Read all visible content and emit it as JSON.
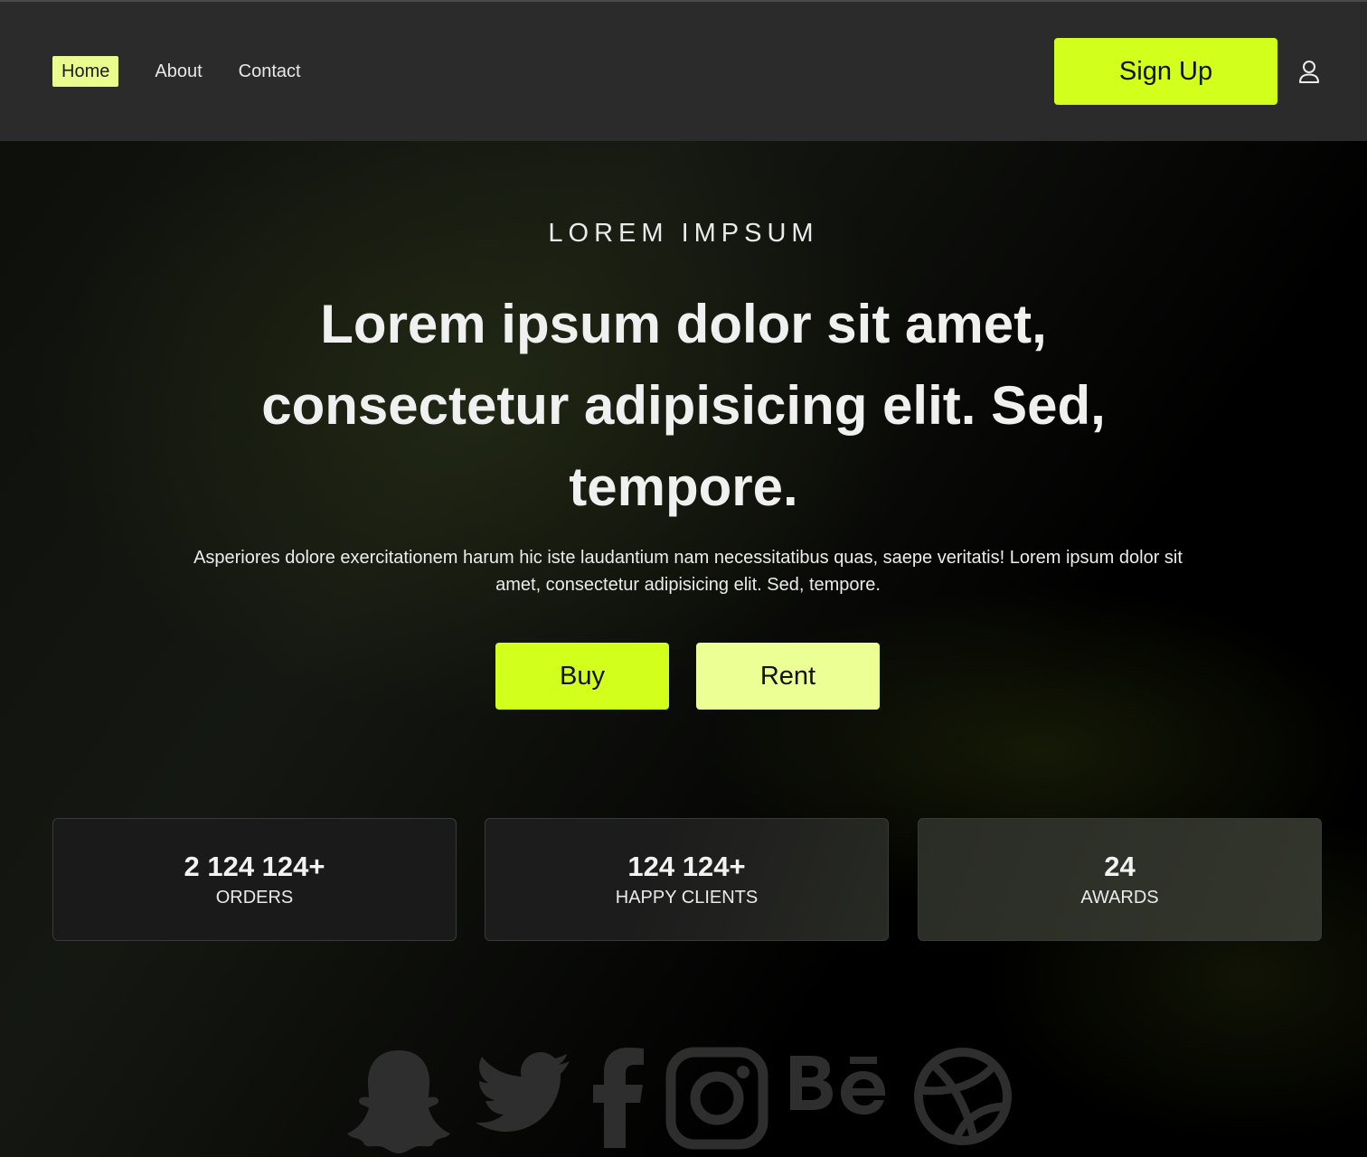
{
  "nav": {
    "links": [
      {
        "label": "Home",
        "active": true
      },
      {
        "label": "About",
        "active": false
      },
      {
        "label": "Contact",
        "active": false
      }
    ],
    "signup_label": "Sign Up",
    "user_icon": "user-icon"
  },
  "hero": {
    "eyebrow": "LOREM IMPSUM",
    "headline": "Lorem ipsum dolor sit amet, consectetur adipisicing elit. Sed, tempore.",
    "subtext": "Asperiores dolore exercitationem harum hic iste laudantium nam necessitatibus quas, saepe veritatis! Lorem ipsum dolor sit amet, consectetur adipisicing elit. Sed, tempore.",
    "buy_label": "Buy",
    "rent_label": "Rent"
  },
  "stats": [
    {
      "value": "2 124 124+",
      "label": "ORDERS"
    },
    {
      "value": "124 124+",
      "label": "HAPPY CLIENTS"
    },
    {
      "value": "24",
      "label": "AWARDS"
    }
  ],
  "socials": [
    "snapchat-icon",
    "twitter-icon",
    "facebook-icon",
    "instagram-icon",
    "behance-icon",
    "dribbble-icon"
  ],
  "colors": {
    "accent": "#d2ff1c",
    "accent_light": "#ecff94",
    "nav_bg": "#2b2b2b",
    "icon_gray": "#2e2e2e"
  }
}
